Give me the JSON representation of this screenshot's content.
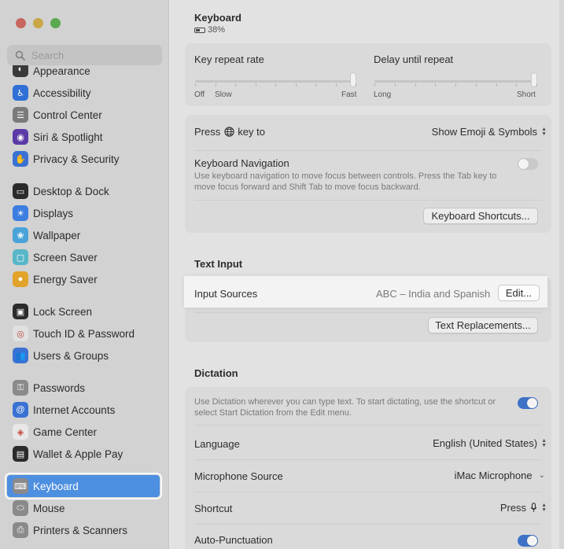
{
  "window": {
    "title": "Keyboard",
    "battery_text": "38%",
    "traffic_lights": [
      "close",
      "minimize",
      "zoom"
    ]
  },
  "search": {
    "placeholder": "Search"
  },
  "sidebar": {
    "items": [
      {
        "label": "Appearance",
        "icon": "appearance-icon",
        "color": "#3a3a3a"
      },
      {
        "label": "Accessibility",
        "icon": "accessibility-icon",
        "color": "#2f6fd6"
      },
      {
        "label": "Control Center",
        "icon": "control-center-icon",
        "color": "#7a7a7a"
      },
      {
        "label": "Siri & Spotlight",
        "icon": "siri-icon",
        "color": "#5b3aa8"
      },
      {
        "label": "Privacy & Security",
        "icon": "hand-icon",
        "color": "#3a72d4"
      },
      {
        "label": "Desktop & Dock",
        "icon": "dock-icon",
        "color": "#2b2b2b"
      },
      {
        "label": "Displays",
        "icon": "sun-icon",
        "color": "#3b7de0"
      },
      {
        "label": "Wallpaper",
        "icon": "wallpaper-icon",
        "color": "#49a3d8"
      },
      {
        "label": "Screen Saver",
        "icon": "screen-saver-icon",
        "color": "#57b6c7"
      },
      {
        "label": "Energy Saver",
        "icon": "bulb-icon",
        "color": "#e2a32b"
      },
      {
        "label": "Lock Screen",
        "icon": "lock-icon",
        "color": "#2b2b2b"
      },
      {
        "label": "Touch ID & Password",
        "icon": "fingerprint-icon",
        "color": "#e0e0e0"
      },
      {
        "label": "Users & Groups",
        "icon": "users-icon",
        "color": "#3a72d4"
      },
      {
        "label": "Passwords",
        "icon": "key-icon",
        "color": "#8a8a8a"
      },
      {
        "label": "Internet Accounts",
        "icon": "at-icon",
        "color": "#3a72d4"
      },
      {
        "label": "Game Center",
        "icon": "game-center-icon",
        "color": "#e8e8e8"
      },
      {
        "label": "Wallet & Apple Pay",
        "icon": "wallet-icon",
        "color": "#2b2b2b"
      },
      {
        "label": "Keyboard",
        "icon": "keyboard-icon",
        "color": "#8a8a8a",
        "selected": true
      },
      {
        "label": "Mouse",
        "icon": "mouse-icon",
        "color": "#8a8a8a"
      },
      {
        "label": "Printers & Scanners",
        "icon": "printer-icon",
        "color": "#8a8a8a"
      }
    ]
  },
  "keyboard_settings": {
    "key_repeat": {
      "label": "Key repeat rate",
      "min_labels": [
        "Off",
        "Slow"
      ],
      "max_label": "Fast",
      "value": 1.0
    },
    "delay_repeat": {
      "label": "Delay until repeat",
      "min_label": "Long",
      "max_label": "Short",
      "value": 1.0
    },
    "press_key": {
      "label_before": "Press",
      "label_after": "key to",
      "value": "Show Emoji & Symbols"
    },
    "keyboard_navigation": {
      "label": "Keyboard Navigation",
      "description": "Use keyboard navigation to move focus between controls. Press the Tab key to move focus forward and Shift Tab to move focus backward.",
      "enabled": false
    },
    "shortcuts_button": "Keyboard Shortcuts..."
  },
  "text_input": {
    "title": "Text Input",
    "input_sources": {
      "label": "Input Sources",
      "value": "ABC – India and Spanish",
      "edit_button": "Edit..."
    },
    "replacements_button": "Text Replacements..."
  },
  "dictation": {
    "title": "Dictation",
    "description": "Use Dictation wherever you can type text. To start dictating, use the shortcut or select Start Dictation from the Edit menu.",
    "enabled": true,
    "language": {
      "label": "Language",
      "value": "English (United States)"
    },
    "microphone": {
      "label": "Microphone Source",
      "value": "iMac Microphone"
    },
    "shortcut": {
      "label": "Shortcut",
      "value": "Press"
    },
    "auto_punctuation": {
      "label": "Auto-Punctuation",
      "enabled": true
    }
  }
}
